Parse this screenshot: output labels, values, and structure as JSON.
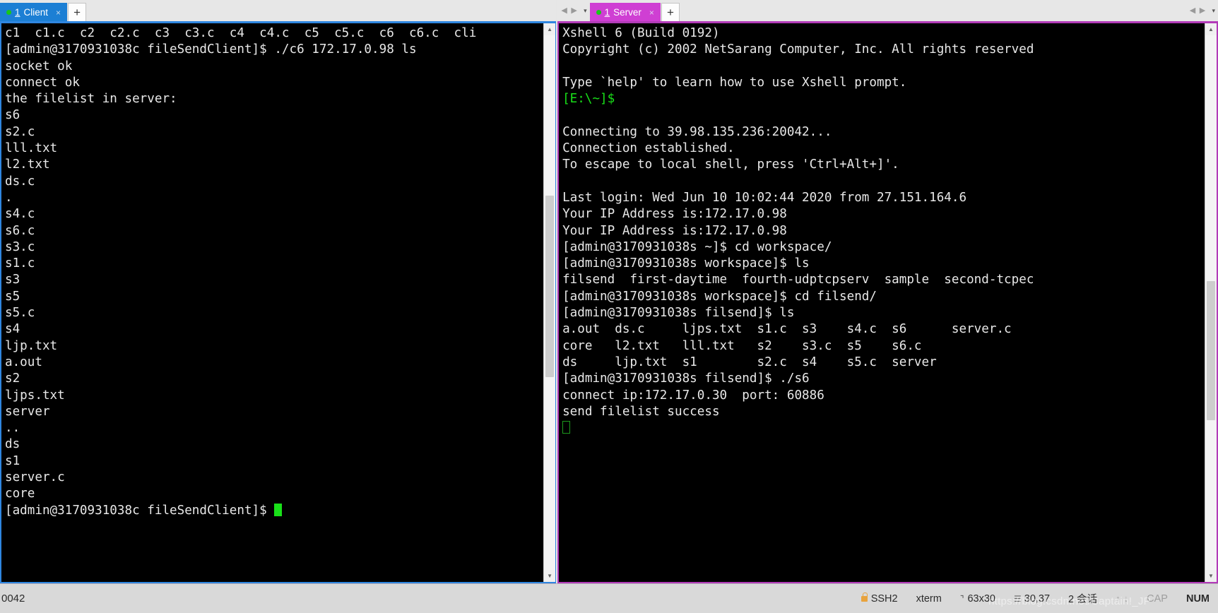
{
  "left_pane": {
    "tab": {
      "dot": "status-dot",
      "number": "1",
      "label": "Client",
      "close": "×"
    },
    "new_tab": "+",
    "terminal_lines": [
      "c1  c1.c  c2  c2.c  c3  c3.c  c4  c4.c  c5  c5.c  c6  c6.c  cli",
      "[admin@3170931038c fileSendClient]$ ./c6 172.17.0.98 ls",
      "socket ok",
      "connect ok",
      "the filelist in server:",
      "s6",
      "s2.c",
      "lll.txt",
      "l2.txt",
      "ds.c",
      ".",
      "s4.c",
      "s6.c",
      "s3.c",
      "s1.c",
      "s3",
      "s5",
      "s5.c",
      "s4",
      "ljp.txt",
      "a.out",
      "s2",
      "ljps.txt",
      "server",
      "..",
      "ds",
      "s1",
      "server.c",
      "core"
    ],
    "prompt": "[admin@3170931038c fileSendClient]$ "
  },
  "right_pane": {
    "nav_left": "◀",
    "nav_right": "▶",
    "nav_caret": "▾",
    "tab": {
      "dot": "status-dot",
      "number": "1",
      "label": "Server",
      "close": "×"
    },
    "new_tab": "+",
    "terminal_lines": [
      "Xshell 6 (Build 0192)",
      "Copyright (c) 2002 NetSarang Computer, Inc. All rights reserved",
      "",
      "Type `help' to learn how to use Xshell prompt."
    ],
    "local_prompt": "[E:\\~]$",
    "terminal_lines2": [
      "",
      "Connecting to 39.98.135.236:20042...",
      "Connection established.",
      "To escape to local shell, press 'Ctrl+Alt+]'.",
      "",
      "Last login: Wed Jun 10 10:02:44 2020 from 27.151.164.6",
      "Your IP Address is:172.17.0.98",
      "Your IP Address is:172.17.0.98",
      "[admin@3170931038s ~]$ cd workspace/",
      "[admin@3170931038s workspace]$ ls",
      "filsend  first-daytime  fourth-udptcpserv  sample  second-tcpec",
      "[admin@3170931038s workspace]$ cd filsend/",
      "[admin@3170931038s filsend]$ ls",
      "a.out  ds.c     ljps.txt  s1.c  s3    s4.c  s6      server.c",
      "core   l2.txt   lll.txt   s2    s3.c  s5    s6.c",
      "ds     ljp.txt  s1        s2.c  s4    s5.c  server",
      "[admin@3170931038s filsend]$ ./s6",
      "connect ip:172.17.0.30  port: 60886",
      "send filelist success",
      ""
    ]
  },
  "statusbar": {
    "left_text": "0042",
    "protocol": "SSH2",
    "terminal_type": "xterm",
    "size": "63x30",
    "cursor_pos": "30,37",
    "sessions": "2 会话",
    "arrow_up": "↑",
    "arrow_down": "↓",
    "caps": "CAP",
    "num": "NUM",
    "watermark": "https://blog.csdn.net/Captain!_JP"
  }
}
